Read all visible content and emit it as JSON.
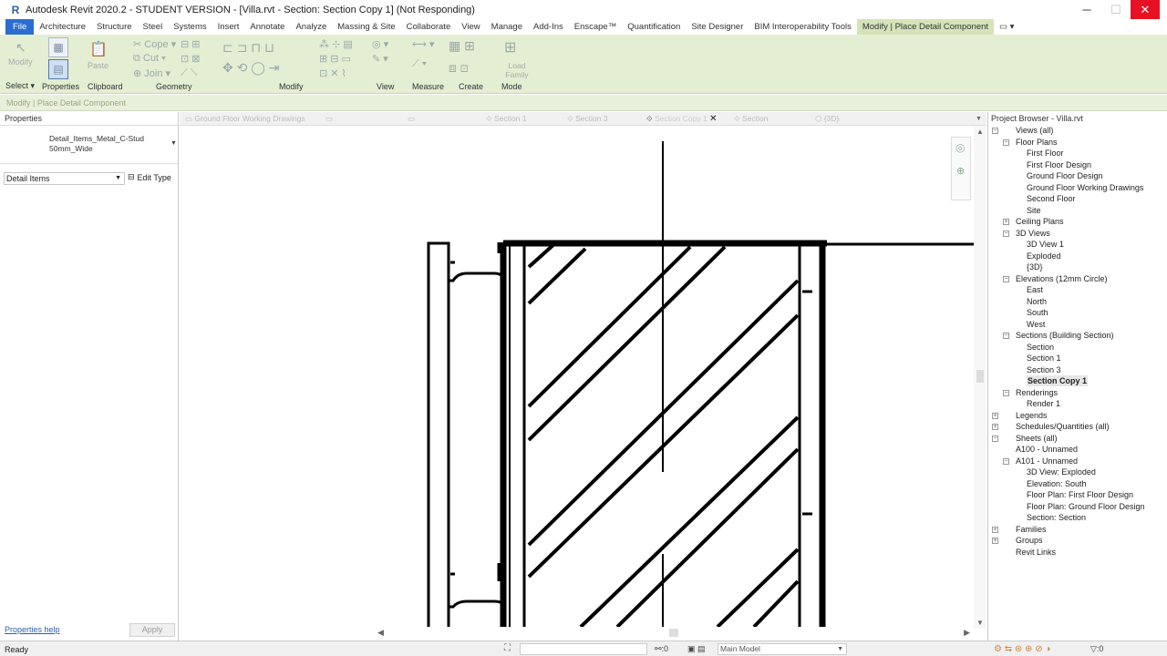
{
  "window": {
    "title": "Autodesk Revit 2020.2 - STUDENT VERSION - [Villa.rvt - Section: Section Copy 1] (Not Responding)",
    "logo": "R",
    "min": "─",
    "max": "☐",
    "close": "✕"
  },
  "tabs": [
    "File",
    "Architecture",
    "Structure",
    "Steel",
    "Systems",
    "Insert",
    "Annotate",
    "Analyze",
    "Massing & Site",
    "Collaborate",
    "View",
    "Manage",
    "Add-Ins",
    "Enscape™",
    "Quantification",
    "Site Designer",
    "BIM Interoperability Tools",
    "Modify | Place Detail Component"
  ],
  "ribbon": {
    "groups": [
      "Select",
      "Properties",
      "Clipboard",
      "Geometry",
      "Modify",
      "View",
      "Measure",
      "Create",
      "Mode"
    ],
    "buttons": {
      "modify": "Modify",
      "paste": "Paste",
      "cope": "Cope",
      "cut": "Cut",
      "join": "Join",
      "load_family": "Load Family"
    }
  },
  "context_bar": "Modify | Place Detail Component",
  "properties": {
    "header": "Properties",
    "type_name_line1": "Detail_Items_Metal_C-Stud",
    "type_name_line2": "50mm_Wide",
    "filter": "Detail Items",
    "edit_type": "Edit Type",
    "help": "Properties help",
    "apply": "Apply"
  },
  "view_tabs": [
    "Ground Floor Working Drawings",
    "",
    "",
    "Section 1",
    "Section 3",
    "Section Copy 1",
    "Section",
    "{3D}"
  ],
  "project_browser": {
    "header": "Project Browser - Villa.rvt",
    "nodes": [
      {
        "label": "Views (all)",
        "level": 0,
        "exp": "-"
      },
      {
        "label": "Floor Plans",
        "level": 1,
        "exp": "-"
      },
      {
        "label": "First Floor",
        "level": 2
      },
      {
        "label": "First Floor Design",
        "level": 2
      },
      {
        "label": "Ground Floor Design",
        "level": 2
      },
      {
        "label": "Ground Floor Working Drawings",
        "level": 2
      },
      {
        "label": "Second Floor",
        "level": 2
      },
      {
        "label": "Site",
        "level": 2
      },
      {
        "label": "Ceiling Plans",
        "level": 1,
        "exp": "+"
      },
      {
        "label": "3D Views",
        "level": 1,
        "exp": "-"
      },
      {
        "label": "3D View 1",
        "level": 2
      },
      {
        "label": "Exploded",
        "level": 2
      },
      {
        "label": "{3D}",
        "level": 2
      },
      {
        "label": "Elevations (12mm Circle)",
        "level": 1,
        "exp": "-"
      },
      {
        "label": "East",
        "level": 2
      },
      {
        "label": "North",
        "level": 2
      },
      {
        "label": "South",
        "level": 2
      },
      {
        "label": "West",
        "level": 2
      },
      {
        "label": "Sections (Building Section)",
        "level": 1,
        "exp": "-"
      },
      {
        "label": "Section",
        "level": 2
      },
      {
        "label": "Section 1",
        "level": 2
      },
      {
        "label": "Section 3",
        "level": 2
      },
      {
        "label": "Section Copy 1",
        "level": 2,
        "bold": true
      },
      {
        "label": "Renderings",
        "level": 1,
        "exp": "-"
      },
      {
        "label": "Render 1",
        "level": 2
      },
      {
        "label": "Legends",
        "level": 0,
        "exp": "+"
      },
      {
        "label": "Schedules/Quantities (all)",
        "level": 0,
        "exp": "+"
      },
      {
        "label": "Sheets (all)",
        "level": 0,
        "exp": "-"
      },
      {
        "label": "A100 - Unnamed",
        "level": 1
      },
      {
        "label": "A101 - Unnamed",
        "level": 1,
        "exp": "-"
      },
      {
        "label": "3D View: Exploded",
        "level": 2
      },
      {
        "label": "Elevation: South",
        "level": 2
      },
      {
        "label": "Floor Plan: First Floor Design",
        "level": 2
      },
      {
        "label": "Floor Plan: Ground Floor Design",
        "level": 2
      },
      {
        "label": "Section: Section",
        "level": 2
      },
      {
        "label": "Families",
        "level": 0,
        "exp": "+"
      },
      {
        "label": "Groups",
        "level": 0,
        "exp": "+"
      },
      {
        "label": "Revit Links",
        "level": 0
      }
    ]
  },
  "status": {
    "text": "Ready",
    "count": ":0",
    "model": "Main Model",
    "filter_count": ":0"
  }
}
